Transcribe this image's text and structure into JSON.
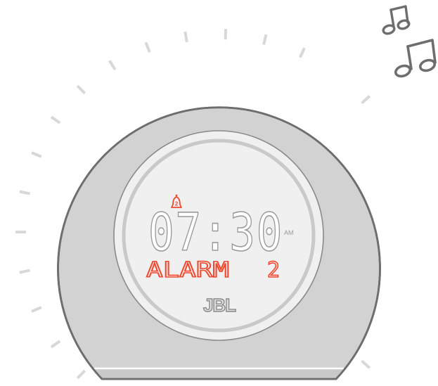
{
  "device": {
    "brand": "JBL",
    "colors": {
      "body": "#d2d2d2",
      "outline": "#6e6e6e",
      "face": "#f0f0f0",
      "ring": "#c9c9c9",
      "digits": "#d9d9d9",
      "accent": "#f0492f",
      "rays": "#d8d8d8",
      "notes": "#6e6e6e"
    }
  },
  "display": {
    "time": "07:30",
    "meridiem": "AM",
    "label": "ALARM",
    "alarm_number": "2",
    "alarm_icon_number": "2",
    "alarm_icon": "alarm-bell-icon"
  },
  "decoration": {
    "light_rays_icon": "light-rays-icon",
    "music_notes_icon": "music-notes-icon"
  }
}
